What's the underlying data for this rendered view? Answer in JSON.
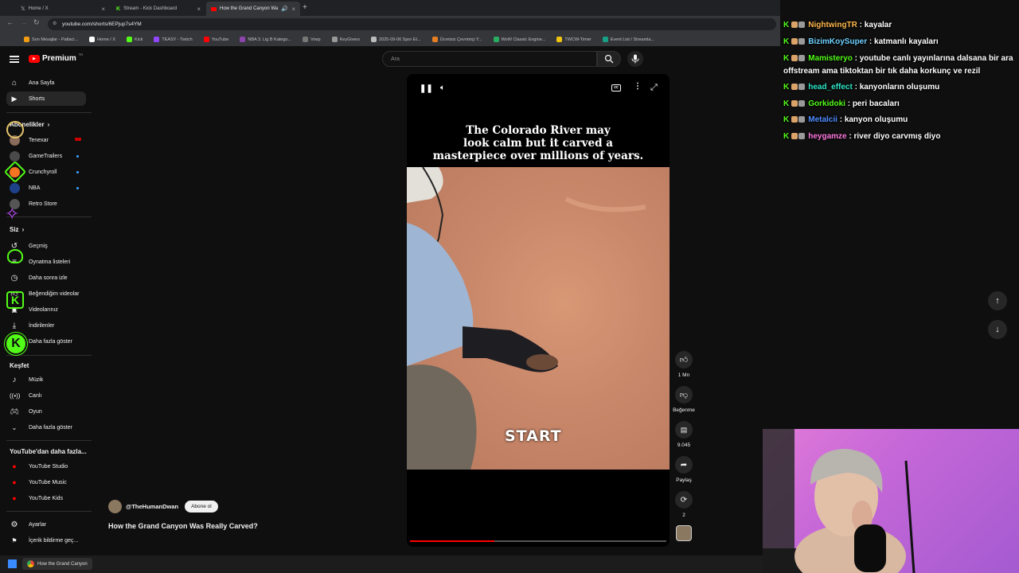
{
  "browser": {
    "tabs": [
      {
        "label": "Home / X",
        "active": false
      },
      {
        "label": "Stream - Kick Dashboard",
        "active": false
      },
      {
        "label": "How the Grand Canyon Wa",
        "active": true
      }
    ],
    "url": "youtube.com/shorts/6EPjup7s4YM",
    "bookmarks": [
      "Son Mesajlar - Patlaci...",
      "Home / X",
      "Kick",
      "TEASY - Twitch",
      "YouTube",
      "NBA 3. Lig B Katego...",
      "Voep",
      "KeyGivers",
      "2025-09-06 Spor Et...",
      "Ücretsiz Çevrimiçi Y...",
      "WoW Classic Engine...",
      "TWCW-Timer",
      "Event List / Streamla..."
    ]
  },
  "youtube": {
    "logo_label": "Premium",
    "logo_sup": "TR",
    "search_placeholder": "Ara",
    "sidebar": {
      "main": [
        {
          "label": "Ana Sayfa",
          "icon": "home-icon"
        },
        {
          "label": "Shorts",
          "icon": "shorts-icon",
          "selected": true
        }
      ],
      "subs_header": "Abonelikler",
      "subs": [
        {
          "label": "Tenexar",
          "color": "#8b6b5a",
          "live": true
        },
        {
          "label": "GameTrailers",
          "color": "#4a4a4a",
          "dot": true
        },
        {
          "label": "Crunchyroll",
          "color": "#f47521",
          "dot": true
        },
        {
          "label": "NBA",
          "color": "#1d428a",
          "dot": true
        },
        {
          "label": "Retro Store",
          "color": "#555555"
        }
      ],
      "you_header": "Siz",
      "you": [
        {
          "label": "Geçmiş",
          "icon": "history-icon"
        },
        {
          "label": "Oynatma listeleri",
          "icon": "playlist-icon"
        },
        {
          "label": "Daha sonra izle",
          "icon": "clock-icon"
        },
        {
          "label": "Beğendiğim videolar",
          "icon": "like-icon"
        },
        {
          "label": "Videolarınız",
          "icon": "video-icon"
        },
        {
          "label": "İndirilenler",
          "icon": "download-icon"
        },
        {
          "label": "Daha fazla göster",
          "icon": "chevron-down-icon"
        }
      ],
      "explore_header": "Keşfet",
      "explore": [
        {
          "label": "Müzik",
          "icon": "music-icon"
        },
        {
          "label": "Canlı",
          "icon": "live-icon"
        },
        {
          "label": "Oyun",
          "icon": "gaming-icon"
        },
        {
          "label": "Daha fazla göster",
          "icon": "chevron-down-icon"
        }
      ],
      "more_header": "YouTube'dan daha fazla...",
      "more": [
        {
          "label": "YouTube Studio"
        },
        {
          "label": "YouTube Music"
        },
        {
          "label": "YouTube Kids"
        }
      ],
      "bottom": [
        {
          "label": "Ayarlar",
          "icon": "gear-icon"
        },
        {
          "label": "İçerik bildirme geç...",
          "icon": "flag-icon"
        }
      ]
    },
    "short": {
      "caption_line1": "The Colorado River may",
      "caption_line2": "look calm but it carved a",
      "caption_line3": "masterpiece over millions of years.",
      "overlay_text": "START",
      "channel": "@TheHumanDwan",
      "subscribe_label": "Abone ol",
      "title": "How the Grand Canyon Was Really Carved?",
      "progress_fraction": 0.33,
      "actions": {
        "likes": "1 Mn",
        "dislike_label": "Beğenme",
        "comments": "9.045",
        "share_label": "Paylaş",
        "remix_count": "2"
      }
    }
  },
  "chat": {
    "messages": [
      {
        "user": "NightwingTR",
        "color": "#ffb84d",
        "text": "kayalar"
      },
      {
        "user": "BizimKoySuper",
        "color": "#6fd1ff",
        "text": "katmanlı kayaları"
      },
      {
        "user": "Mamisteryo",
        "color": "#53fc18",
        "text": "youtube canlı yayınlarına dalsana bir ara offstream ama tiktoktan bir tık daha korkunç ve rezil"
      },
      {
        "user": "head_effect",
        "color": "#2ee6c8",
        "text": "kanyonların oluşumu"
      },
      {
        "user": "Gorkidoki",
        "color": "#53fc18",
        "text": "peri bacaları"
      },
      {
        "user": "Metalcii",
        "color": "#4f8dff",
        "text": "kanyon oluşumu"
      },
      {
        "user": "heygamze",
        "color": "#ff7ae0",
        "text": "river diyo carvmış diyo"
      }
    ]
  },
  "taskbar": {
    "app_label": "How the Grand Canyon"
  }
}
